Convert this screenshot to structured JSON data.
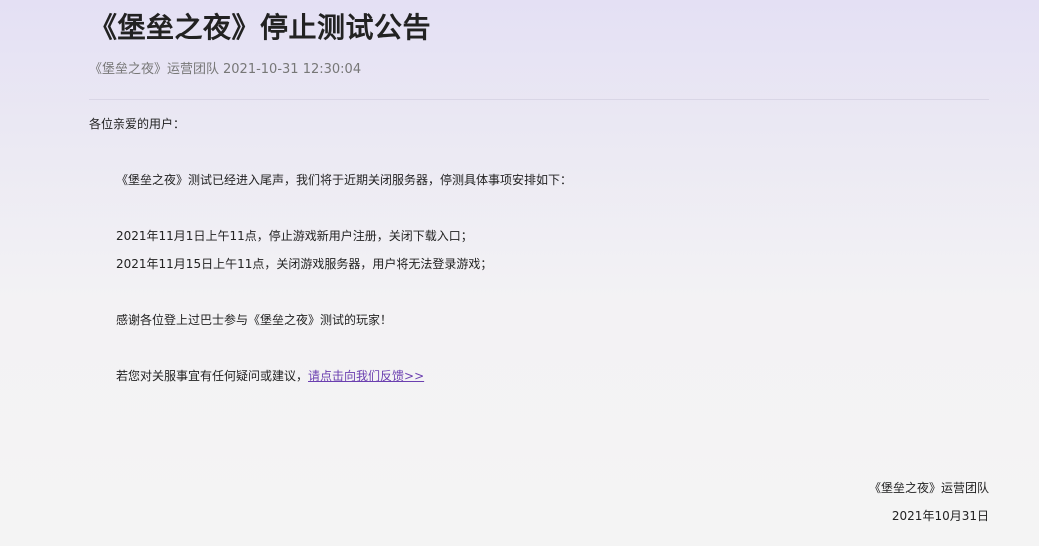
{
  "article": {
    "title": "《堡垒之夜》停止测试公告",
    "author": "《堡垒之夜》运营团队",
    "timestamp": "2021-10-31 12:30:04"
  },
  "body": {
    "greeting": "各位亲爱的用户：",
    "intro": "《堡垒之夜》测试已经进入尾声，我们将于近期关闭服务器，停测具体事项安排如下：",
    "schedule": [
      "2021年11月1日上午11点，停止游戏新用户注册，关闭下载入口；",
      "2021年11月15日上午11点，关闭游戏服务器，用户将无法登录游戏；"
    ],
    "thanks": "感谢各位登上过巴士参与《堡垒之夜》测试的玩家！",
    "feedback_prefix": "若您对关服事宜有任何疑问或建议，",
    "feedback_link": "请点击向我们反馈>>"
  },
  "signature": {
    "team": "《堡垒之夜》运营团队",
    "date": "2021年10月31日"
  },
  "colors": {
    "link": "#6b3fb0",
    "divider": "#d9d6e6"
  }
}
